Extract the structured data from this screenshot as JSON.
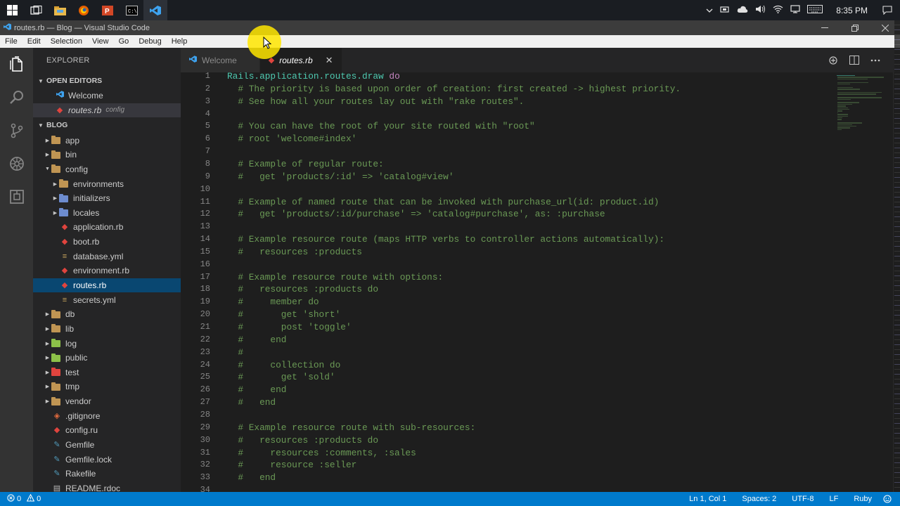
{
  "taskbar": {
    "icons": [
      "windows-start-icon",
      "task-view-icon",
      "file-explorer-icon",
      "firefox-icon",
      "powerpoint-icon",
      "cmd-icon",
      "vscode-icon"
    ],
    "clock": "8:35 PM"
  },
  "window": {
    "title": "routes.rb — Blog — Visual Studio Code"
  },
  "menu": [
    "File",
    "Edit",
    "Selection",
    "View",
    "Go",
    "Debug",
    "Help"
  ],
  "sidebar": {
    "title": "EXPLORER",
    "open_editors_header": "OPEN EDITORS",
    "open_editors": [
      {
        "label": "Welcome",
        "desc": ""
      },
      {
        "label": "routes.rb",
        "desc": "config"
      }
    ],
    "project_header": "BLOG",
    "tree": [
      {
        "label": "app",
        "depth": 1,
        "type": "folder",
        "expanded": false
      },
      {
        "label": "bin",
        "depth": 1,
        "type": "folder",
        "expanded": false
      },
      {
        "label": "config",
        "depth": 1,
        "type": "folder",
        "expanded": true
      },
      {
        "label": "environments",
        "depth": 2,
        "type": "folder",
        "expanded": false
      },
      {
        "label": "initializers",
        "depth": 2,
        "type": "folder-blue",
        "expanded": false
      },
      {
        "label": "locales",
        "depth": 2,
        "type": "folder-blue",
        "expanded": false
      },
      {
        "label": "application.rb",
        "depth": 2,
        "type": "ruby"
      },
      {
        "label": "boot.rb",
        "depth": 2,
        "type": "ruby"
      },
      {
        "label": "database.yml",
        "depth": 2,
        "type": "yml"
      },
      {
        "label": "environment.rb",
        "depth": 2,
        "type": "ruby"
      },
      {
        "label": "routes.rb",
        "depth": 2,
        "type": "ruby",
        "selected": true
      },
      {
        "label": "secrets.yml",
        "depth": 2,
        "type": "yml"
      },
      {
        "label": "db",
        "depth": 1,
        "type": "folder",
        "expanded": false
      },
      {
        "label": "lib",
        "depth": 1,
        "type": "folder",
        "expanded": false
      },
      {
        "label": "log",
        "depth": 1,
        "type": "folder-green",
        "expanded": false
      },
      {
        "label": "public",
        "depth": 1,
        "type": "folder-green",
        "expanded": false
      },
      {
        "label": "test",
        "depth": 1,
        "type": "folder-red",
        "expanded": false
      },
      {
        "label": "tmp",
        "depth": 1,
        "type": "folder",
        "expanded": false
      },
      {
        "label": "vendor",
        "depth": 1,
        "type": "folder",
        "expanded": false
      },
      {
        "label": ".gitignore",
        "depth": 1,
        "type": "git"
      },
      {
        "label": "config.ru",
        "depth": 1,
        "type": "ruby"
      },
      {
        "label": "Gemfile",
        "depth": 1,
        "type": "gem"
      },
      {
        "label": "Gemfile.lock",
        "depth": 1,
        "type": "gem"
      },
      {
        "label": "Rakefile",
        "depth": 1,
        "type": "gem"
      },
      {
        "label": "README.rdoc",
        "depth": 1,
        "type": "doc"
      }
    ]
  },
  "tabs": [
    {
      "label": "Welcome",
      "active": false
    },
    {
      "label": "routes.rb",
      "active": true
    }
  ],
  "editor": {
    "lines": [
      "Rails.application.routes.draw do",
      "  # The priority is based upon order of creation: first created -> highest priority.",
      "  # See how all your routes lay out with \"rake routes\".",
      "",
      "  # You can have the root of your site routed with \"root\"",
      "  # root 'welcome#index'",
      "",
      "  # Example of regular route:",
      "  #   get 'products/:id' => 'catalog#view'",
      "",
      "  # Example of named route that can be invoked with purchase_url(id: product.id)",
      "  #   get 'products/:id/purchase' => 'catalog#purchase', as: :purchase",
      "",
      "  # Example resource route (maps HTTP verbs to controller actions automatically):",
      "  #   resources :products",
      "",
      "  # Example resource route with options:",
      "  #   resources :products do",
      "  #     member do",
      "  #       get 'short'",
      "  #       post 'toggle'",
      "  #     end",
      "  #",
      "  #     collection do",
      "  #       get 'sold'",
      "  #     end",
      "  #   end",
      "",
      "  # Example resource route with sub-resources:",
      "  #   resources :products do",
      "  #     resources :comments, :sales",
      "  #     resource :seller",
      "  #   end",
      ""
    ]
  },
  "status": {
    "errors": "0",
    "warnings": "0",
    "position": "Ln 1, Col 1",
    "spaces": "Spaces: 2",
    "encoding": "UTF-8",
    "eol": "LF",
    "language": "Ruby"
  },
  "colors": {
    "accent": "#007acc",
    "selection": "#094771",
    "comment": "#6a9955"
  }
}
